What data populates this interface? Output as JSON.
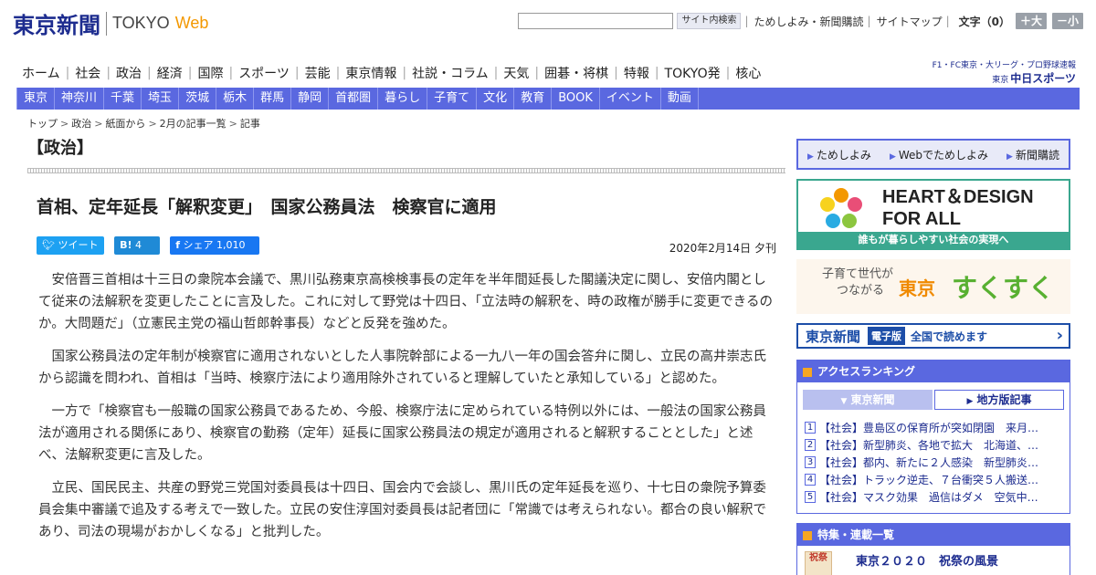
{
  "header": {
    "logo_jp": "東京新聞",
    "logo_en": "TOKYO",
    "logo_web": "Web",
    "search_placeholder": "",
    "search_button": "サイト内検索",
    "link_trial": "ためしよみ・新聞購読",
    "link_sitemap": "サイトマップ",
    "font_size_label": "文字（0）",
    "size_plus": "＋大",
    "size_minus": "－小"
  },
  "main_nav": [
    "ホーム",
    "社会",
    "政治",
    "経済",
    "国際",
    "スポーツ",
    "芸能",
    "東京情報",
    "社説・コラム",
    "天気",
    "囲碁・将棋",
    "特報",
    "TOKYO発",
    "核心"
  ],
  "sports_banner": {
    "small": "F1・FC東京・大リーグ・プロ野球速報",
    "prefix": "東京",
    "name": "中日スポーツ"
  },
  "region_nav": [
    "東京",
    "神奈川",
    "千葉",
    "埼玉",
    "茨城",
    "栃木",
    "群馬",
    "静岡",
    "首都圏",
    "暮らし",
    "子育て",
    "文化",
    "教育",
    "BOOK",
    "イベント",
    "動画"
  ],
  "breadcrumb": [
    "トップ",
    "政治",
    "紙面から",
    "2月の記事一覧",
    "記事"
  ],
  "article": {
    "section": "【政治】",
    "headline": "首相、定年延長「解釈変更」　国家公務員法　検察官に適用",
    "share": {
      "tweet": "ツイート",
      "hatena_count": "4",
      "fb_label": "シェア",
      "fb_count": "1,010"
    },
    "date": "2020年2月14日 夕刊",
    "paragraphs": [
      "安倍晋三首相は十三日の衆院本会議で、黒川弘務東京高検検事長の定年を半年間延長した閣議決定に関し、安倍内閣として従来の法解釈を変更したことに言及した。これに対して野党は十四日、「立法時の解釈を、時の政権が勝手に変更できるのか。大問題だ」（立憲民主党の福山哲郎幹事長）などと反発を強めた。",
      "国家公務員法の定年制が検察官に適用されないとした人事院幹部による一九八一年の国会答弁に関し、立民の高井崇志氏から認識を問われ、首相は「当時、検察庁法により適用除外されていると理解していたと承知している」と認めた。",
      "一方で「検察官も一般職の国家公務員であるため、今般、検察庁法に定められている特例以外には、一般法の国家公務員法が適用される関係にあり、検察官の勤務（定年）延長に国家公務員法の規定が適用されると解釈することとした」と述べ、法解釈変更に言及した。",
      "立民、国民民主、共産の野党三党国対委員長は十四日、国会内で会談し、黒川氏の定年延長を巡り、十七日の衆院予算委員会集中審議で追及する考えで一致した。立民の安住淳国対委員長は記者団に「常識では考えられない。都合の良い解釈であり、司法の現場がおかしくなる」と批判した。"
    ]
  },
  "sidebar": {
    "links": [
      "ためしよみ",
      "Webでためしよみ",
      "新聞購読"
    ],
    "heart_title_1": "HEART＆DESIGN",
    "heart_title_2": "FOR ALL",
    "heart_sub": "誰もが暮らしやすい社会の実現へ",
    "suku_small_1": "子育て世代が",
    "suku_small_2": "つながる",
    "suku_tokyo": "東京",
    "suku_big": "すくすく",
    "denshi_logo": "東京新聞",
    "denshi_tag": "電子版",
    "denshi_text": "全国で読めます",
    "ranking_title": "アクセスランキング",
    "ranking_tab_1": "東京新聞",
    "ranking_tab_2": "地方版記事",
    "ranking": [
      {
        "num": "1",
        "title": "【社会】豊島区の保育所が突如閉園　来月…"
      },
      {
        "num": "2",
        "title": "【社会】新型肺炎、各地で拡大　北海道、…"
      },
      {
        "num": "3",
        "title": "【社会】都内、新たに２人感染　新型肺炎…"
      },
      {
        "num": "4",
        "title": "【社会】トラック逆走、７台衝突５人搬送…"
      },
      {
        "num": "5",
        "title": "【社会】マスク効果　過信はダメ　空気中…"
      }
    ],
    "feature_title": "特集・連載一覧",
    "feature_item": "東京２０２０　祝祭の風景",
    "feature_thumb": "祝祭"
  },
  "colors": {
    "brand": "#1d2c8f",
    "nav_bar": "#5a68e0",
    "web_accent": "#f39800"
  }
}
